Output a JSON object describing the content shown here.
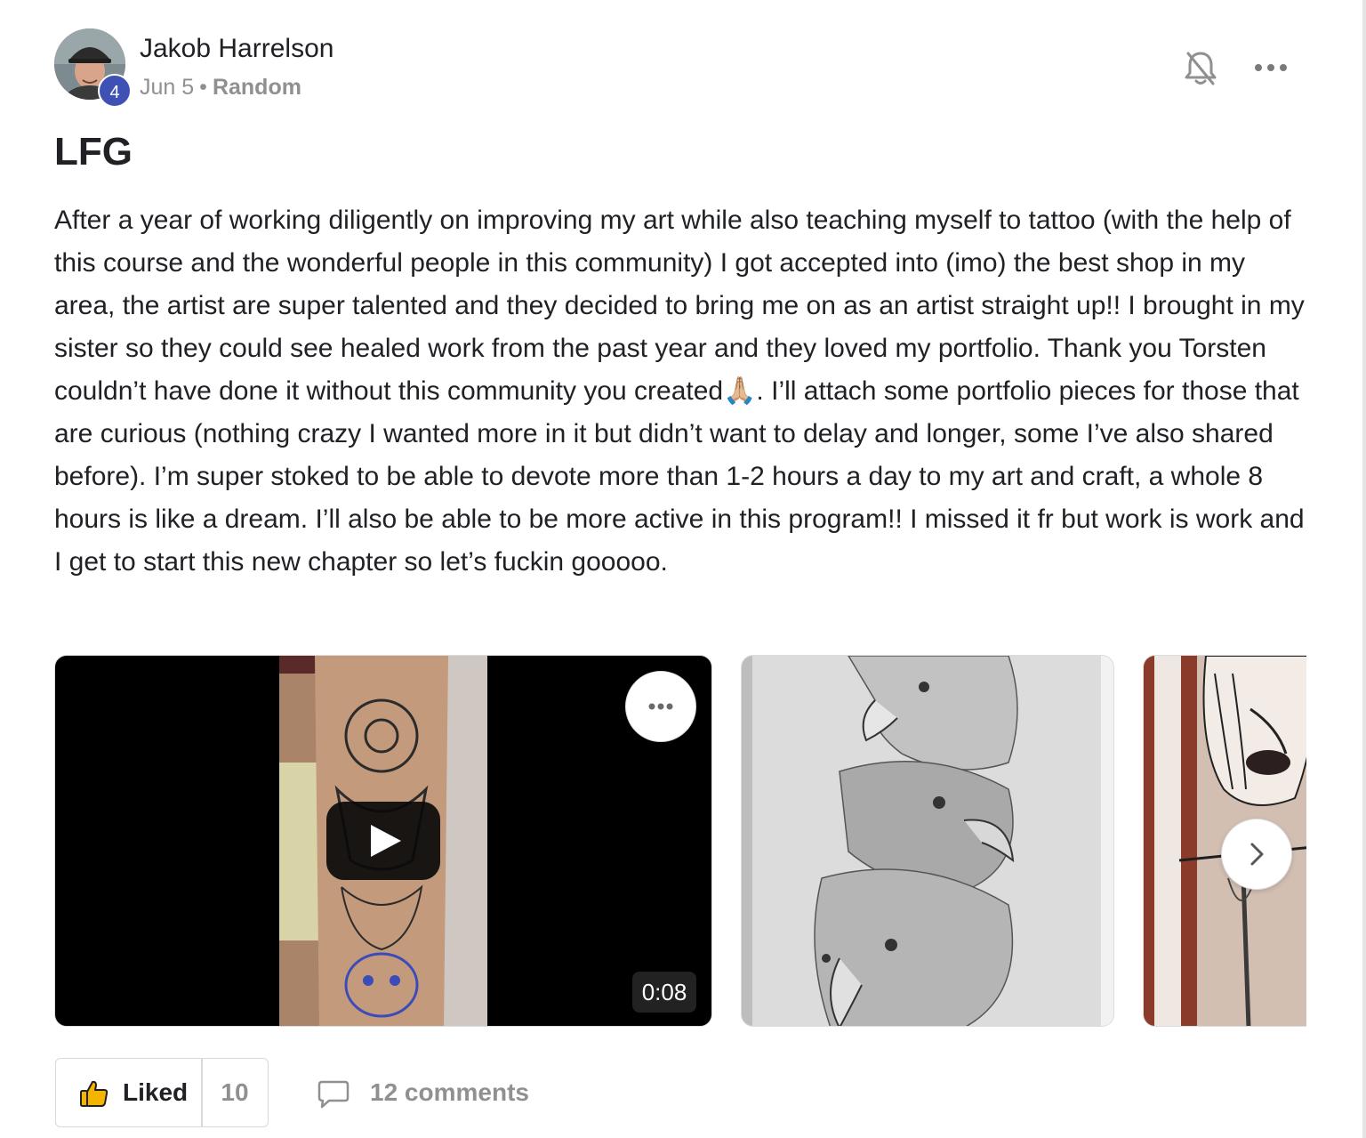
{
  "author": {
    "name": "Jakob Harrelson",
    "level": "4",
    "avatar_icon": "user-avatar"
  },
  "post": {
    "date": "Jun 5",
    "separator": "•",
    "category": "Random",
    "title": "LFG",
    "body": "After a year of working diligently on improving my art while also teaching myself to tattoo (with the help of this course and the wonderful people in this community) I got accepted into (imo) the best shop in my area, the artist are super talented and they decided to bring me on as an artist straight up!! I brought in my sister so they could see healed work from the past year and they loved my portfolio. Thank you Torsten couldn’t have done it without this community you created🙏🏼. I’ll attach some portfolio pieces for those that are curious (nothing crazy I wanted more in it but didn’t want to delay and longer, some I’ve also shared before). I’m super stoked to be able to devote more than 1-2 hours a day to my art and craft, a whole 8 hours is like a dream. I’ll also be able to be more active in this program!! I missed it fr but work is work and I get to start this new chapter so let’s fuckin gooooo."
  },
  "header_icons": [
    "bell-off-icon",
    "more-icon"
  ],
  "media": {
    "video": {
      "duration": "0:08",
      "icons": [
        "play-icon",
        "more-icon"
      ]
    },
    "images": [
      {
        "subject": "eagle-drawing"
      },
      {
        "subject": "portrait-drawing"
      }
    ],
    "next_icon": "chevron-right-icon"
  },
  "footer": {
    "like_label": "Liked",
    "like_count": "10",
    "comments_label": "12 comments"
  },
  "colors": {
    "level_badge": "#3f51b5",
    "muted_text": "#909090",
    "primary_text": "#202124",
    "border": "#d9d9d9"
  }
}
